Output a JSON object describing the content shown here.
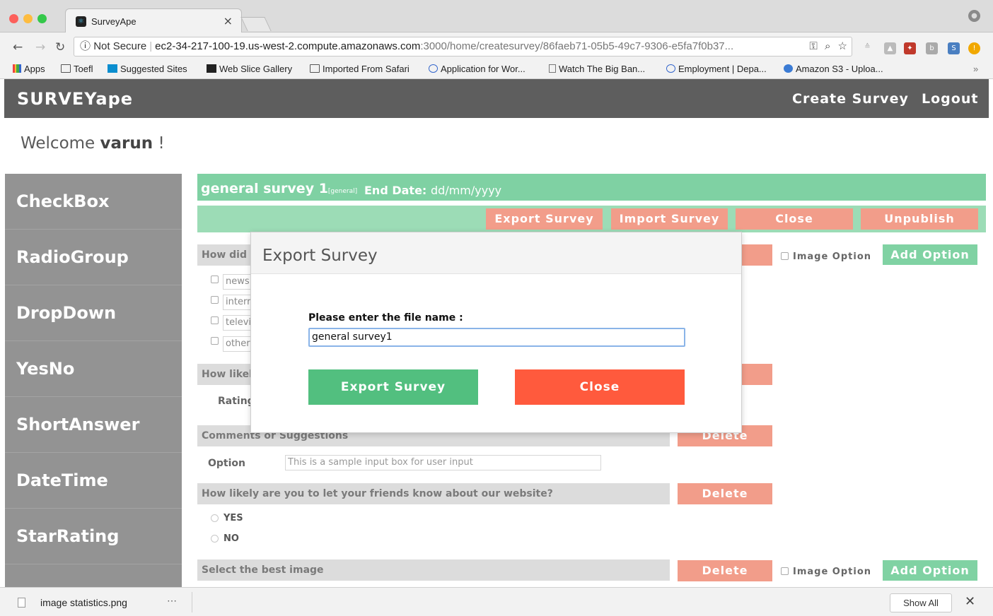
{
  "browser": {
    "tab_title": "SurveyApe",
    "tab_close": "×",
    "url_security": "Not Secure",
    "url_host": "ec2-34-217-100-19.us-west-2.compute.amazonaws.com",
    "url_path": ":3000/home/createsurvey/86faeb71-05b5-49c7-9306-e5fa7f0b37...",
    "bookmarks": [
      {
        "label": "Apps"
      },
      {
        "label": "Toefl"
      },
      {
        "label": "Suggested Sites"
      },
      {
        "label": "Web Slice Gallery"
      },
      {
        "label": "Imported From Safari"
      },
      {
        "label": "Application for Wor..."
      },
      {
        "label": "Watch The Big Ban..."
      },
      {
        "label": "Employment | Depa..."
      },
      {
        "label": "Amazon S3 - Uploa..."
      }
    ],
    "bookmarks_overflow": "»"
  },
  "app": {
    "brand": "SURVEYape",
    "nav_create": "Create Survey",
    "nav_logout": "Logout",
    "welcome_prefix": "Welcome",
    "welcome_user": "varun",
    "welcome_suffix": "!"
  },
  "sidebar": {
    "items": [
      {
        "label": "CheckBox"
      },
      {
        "label": "RadioGroup"
      },
      {
        "label": "DropDown"
      },
      {
        "label": "YesNo"
      },
      {
        "label": "ShortAnswer"
      },
      {
        "label": "DateTime"
      },
      {
        "label": "StarRating"
      }
    ]
  },
  "survey": {
    "title": "general survey 1",
    "tag": "[general]",
    "end_date_label": "End Date:",
    "end_date_value": "dd/mm/yyyy",
    "actions": {
      "export": "Export Survey",
      "import": "Import Survey",
      "close": "Close",
      "unpublish": "Unpublish"
    },
    "q1": {
      "text": "How did y",
      "delete": "e",
      "image_option": "Image Option",
      "add_option": "Add Option",
      "options": [
        "news",
        "interr",
        "televi",
        "other"
      ]
    },
    "q2": {
      "text": "How likely",
      "delete": "e",
      "rating_label": "Rating"
    },
    "q3": {
      "text": "Comments or Suggestions",
      "delete": "Delete",
      "option_label": "Option",
      "input_placeholder": "This is a sample input box for user input"
    },
    "q4": {
      "text": "How likely are you to let your friends know about our website?",
      "delete": "Delete",
      "options": [
        "YES",
        "NO"
      ]
    },
    "q5": {
      "text": "Select the best image",
      "delete": "Delete",
      "image_option": "Image Option",
      "add_option": "Add Option"
    }
  },
  "modal": {
    "title": "Export Survey",
    "label": "Please enter the file name :",
    "input_value": "general survey1",
    "export_button": "Export Survey",
    "close_button": "Close"
  },
  "downloads": {
    "file": "image statistics.png",
    "more": "⋯",
    "show_all": "Show All",
    "close": "✕"
  },
  "colors": {
    "header": "#5e5e5e",
    "sidebar": "#939393",
    "survey_green": "#7fd1a3",
    "salmon": "#f29d8a",
    "export_green": "#52bf7f",
    "close_red": "#ff5a3d"
  }
}
